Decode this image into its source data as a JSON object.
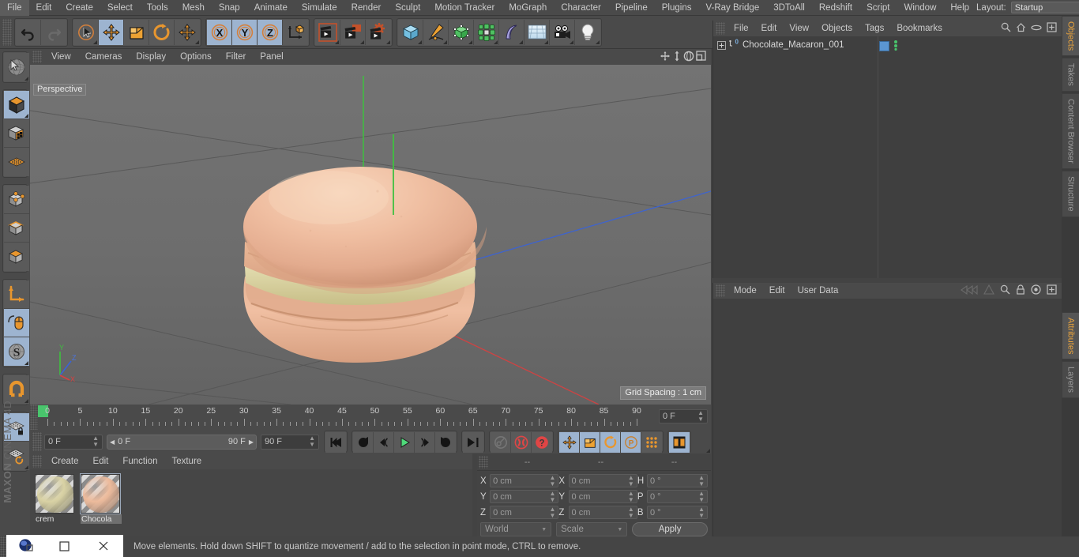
{
  "menubar": {
    "items": [
      "File",
      "Edit",
      "Create",
      "Select",
      "Tools",
      "Mesh",
      "Snap",
      "Animate",
      "Simulate",
      "Render",
      "Sculpt",
      "Motion Tracker",
      "MoGraph",
      "Character",
      "Pipeline",
      "Plugins",
      "V-Ray Bridge",
      "3DToAll",
      "Redshift",
      "Script",
      "Window",
      "Help"
    ],
    "layout_label": "Layout:",
    "layout_value": "Startup",
    "search_icon": "search-icon"
  },
  "toolbar": {
    "groups": [
      {
        "name": "history",
        "buttons": [
          {
            "icon": "undo-icon",
            "active": false
          },
          {
            "icon": "redo-icon",
            "active": false,
            "dim": true
          }
        ]
      },
      {
        "name": "transform",
        "buttons": [
          {
            "icon": "select-live-icon",
            "active": false
          },
          {
            "icon": "move-icon",
            "active": true
          },
          {
            "icon": "scale-icon",
            "active": false
          },
          {
            "icon": "rotate-icon",
            "active": false
          },
          {
            "icon": "move-dup-icon",
            "active": false
          }
        ]
      },
      {
        "name": "axis-locks",
        "buttons": [
          {
            "icon": "axis-x-icon",
            "active": true
          },
          {
            "icon": "axis-y-icon",
            "active": true
          },
          {
            "icon": "axis-z-icon",
            "active": true
          },
          {
            "icon": "world-object-axis-icon",
            "active": false
          }
        ]
      },
      {
        "name": "render",
        "buttons": [
          {
            "icon": "render-view-icon",
            "active": false
          },
          {
            "icon": "render-to-picture-viewer-icon",
            "active": false
          },
          {
            "icon": "render-settings-icon",
            "active": false
          }
        ]
      },
      {
        "name": "create",
        "buttons": [
          {
            "icon": "cube-primitive-icon",
            "active": false
          },
          {
            "icon": "spline-pen-icon",
            "active": false
          },
          {
            "icon": "generator-nurbs-icon",
            "active": false
          },
          {
            "icon": "mograph-cloner-icon",
            "active": false
          },
          {
            "icon": "deformer-bend-icon",
            "active": false
          },
          {
            "icon": "environment-floor-icon",
            "active": false
          },
          {
            "icon": "camera-icon",
            "active": false
          },
          {
            "icon": "light-icon",
            "active": false
          }
        ]
      }
    ]
  },
  "leftbar": {
    "groups": [
      {
        "buttons": [
          {
            "icon": "live-selection-icon",
            "active": false
          }
        ]
      },
      {
        "buttons": [
          {
            "icon": "make-editable-icon",
            "active": true
          },
          {
            "icon": "model-mode-icon",
            "active": false
          },
          {
            "icon": "texture-mode-icon",
            "active": false
          }
        ]
      },
      {
        "buttons": [
          {
            "icon": "points-mode-icon",
            "active": false
          },
          {
            "icon": "edges-mode-icon",
            "active": false
          },
          {
            "icon": "polygons-mode-icon",
            "active": false
          }
        ]
      },
      {
        "buttons": [
          {
            "icon": "axis-modify-icon",
            "active": false
          },
          {
            "icon": "enable-axis-icon",
            "active": true
          },
          {
            "icon": "soft-selection-icon",
            "active": true
          }
        ]
      },
      {
        "buttons": [
          {
            "icon": "snap-magnet-icon",
            "active": false
          }
        ]
      },
      {
        "buttons": [
          {
            "icon": "workplane-lock-icon",
            "active": true
          },
          {
            "icon": "workplane-rotate-icon",
            "active": false
          }
        ]
      }
    ],
    "brand_top": "MAXON",
    "brand_bottom": "CINEMA 4D"
  },
  "viewport": {
    "menu": [
      "View",
      "Cameras",
      "Display",
      "Options",
      "Filter",
      "Panel"
    ],
    "header_icons": [
      "move-camera-icon",
      "dolly-camera-icon",
      "rotate-camera-icon",
      "maximize-viewport-icon"
    ],
    "label": "Perspective",
    "grid_spacing": "Grid Spacing : 1 cm",
    "axis_labels": {
      "y": "Y",
      "z": "Z",
      "x": "X"
    },
    "axis_colors": {
      "x": "#d94040",
      "y": "#3fc03f",
      "z": "#3a63d8"
    },
    "object_colors": {
      "shell_light": "#f0bfa2",
      "shell_mid": "#e3ab8e",
      "shell_dark": "#cf9577",
      "filling": "#d8cf9b"
    }
  },
  "timeline": {
    "ticks": [
      0,
      5,
      10,
      15,
      20,
      25,
      30,
      35,
      40,
      45,
      50,
      55,
      60,
      65,
      70,
      75,
      80,
      85,
      90
    ],
    "current_frame_field": "0 F",
    "green_marker_frame": 0
  },
  "animbar": {
    "start_field": "0 F",
    "range_left": "0 F",
    "range_right": "90 F",
    "end_field": "90 F",
    "transport": [
      {
        "icon": "go-to-start-icon",
        "active": false
      },
      {
        "icon": "previous-key-icon",
        "active": false
      },
      {
        "icon": "step-back-icon",
        "active": false
      },
      {
        "icon": "play-icon",
        "active": false
      },
      {
        "icon": "step-forward-icon",
        "active": false
      },
      {
        "icon": "next-key-icon",
        "active": false
      },
      {
        "icon": "go-to-end-icon",
        "active": false
      }
    ],
    "record_group": [
      {
        "icon": "autokey-icon",
        "active": false,
        "dim": true
      },
      {
        "icon": "record-active-objects-icon",
        "active": false
      },
      {
        "icon": "keyframe-selection-icon",
        "active": false
      }
    ],
    "param_group": [
      {
        "icon": "record-position-icon",
        "active": true
      },
      {
        "icon": "record-scale-icon",
        "active": true
      },
      {
        "icon": "record-rotation-icon",
        "active": true
      },
      {
        "icon": "record-parameter-icon",
        "active": true
      },
      {
        "icon": "record-pla-icon",
        "active": false
      }
    ],
    "timeline_toggle": {
      "icon": "timeline-toggle-icon",
      "active": true
    }
  },
  "material_manager": {
    "menu": [
      "Create",
      "Edit",
      "Function",
      "Texture"
    ],
    "materials": [
      {
        "name": "crem",
        "color": "#d9d2a4",
        "selected": false
      },
      {
        "name": "Chocola",
        "color": "#edbb9c",
        "selected": true
      }
    ]
  },
  "coordinates": {
    "header": [
      "--",
      "--",
      "--"
    ],
    "rows": [
      {
        "label1": "X",
        "value1": "0 cm",
        "label2": "X",
        "value2": "0 cm",
        "label3": "H",
        "value3": "0 °"
      },
      {
        "label1": "Y",
        "value1": "0 cm",
        "label2": "Y",
        "value2": "0 cm",
        "label3": "P",
        "value3": "0 °"
      },
      {
        "label1": "Z",
        "value1": "0 cm",
        "label2": "Z",
        "value2": "0 cm",
        "label3": "B",
        "value3": "0 °"
      }
    ],
    "system": "World",
    "mode": "Scale",
    "apply": "Apply"
  },
  "object_manager": {
    "menu": [
      "File",
      "Edit",
      "View",
      "Objects",
      "Tags",
      "Bookmarks"
    ],
    "icons": [
      "search-icon",
      "home-icon",
      "ellipse-icon",
      "add-layer-icon"
    ],
    "object": {
      "name": "Chocolate_Macaron_001",
      "level_badge": "0",
      "tag_color": "#5b96d2",
      "dots_color": "#49c46c"
    }
  },
  "attribute_manager": {
    "menu": [
      "Mode",
      "Edit",
      "User Data"
    ],
    "icons": [
      "forward-nav-icon",
      "up-nav-icon",
      "search-icon",
      "lock-icon",
      "target-icon",
      "add-tab-icon"
    ]
  },
  "right_tabs": {
    "top": [
      {
        "label": "Objects",
        "active": true
      },
      {
        "label": "Takes",
        "active": false
      },
      {
        "label": "Content Browser",
        "active": false
      },
      {
        "label": "Structure",
        "active": false
      }
    ],
    "bottom": [
      {
        "label": "Attributes",
        "active": true
      },
      {
        "label": "Layers",
        "active": false
      }
    ]
  },
  "statusbar": {
    "message": "Move elements. Hold down SHIFT to quantize movement / add to the selection in point mode, CTRL to remove."
  },
  "taskbar": {
    "items": [
      "c4d-app-icon",
      "restore-window-icon",
      "maximize-window-icon",
      "close-window-icon"
    ]
  }
}
